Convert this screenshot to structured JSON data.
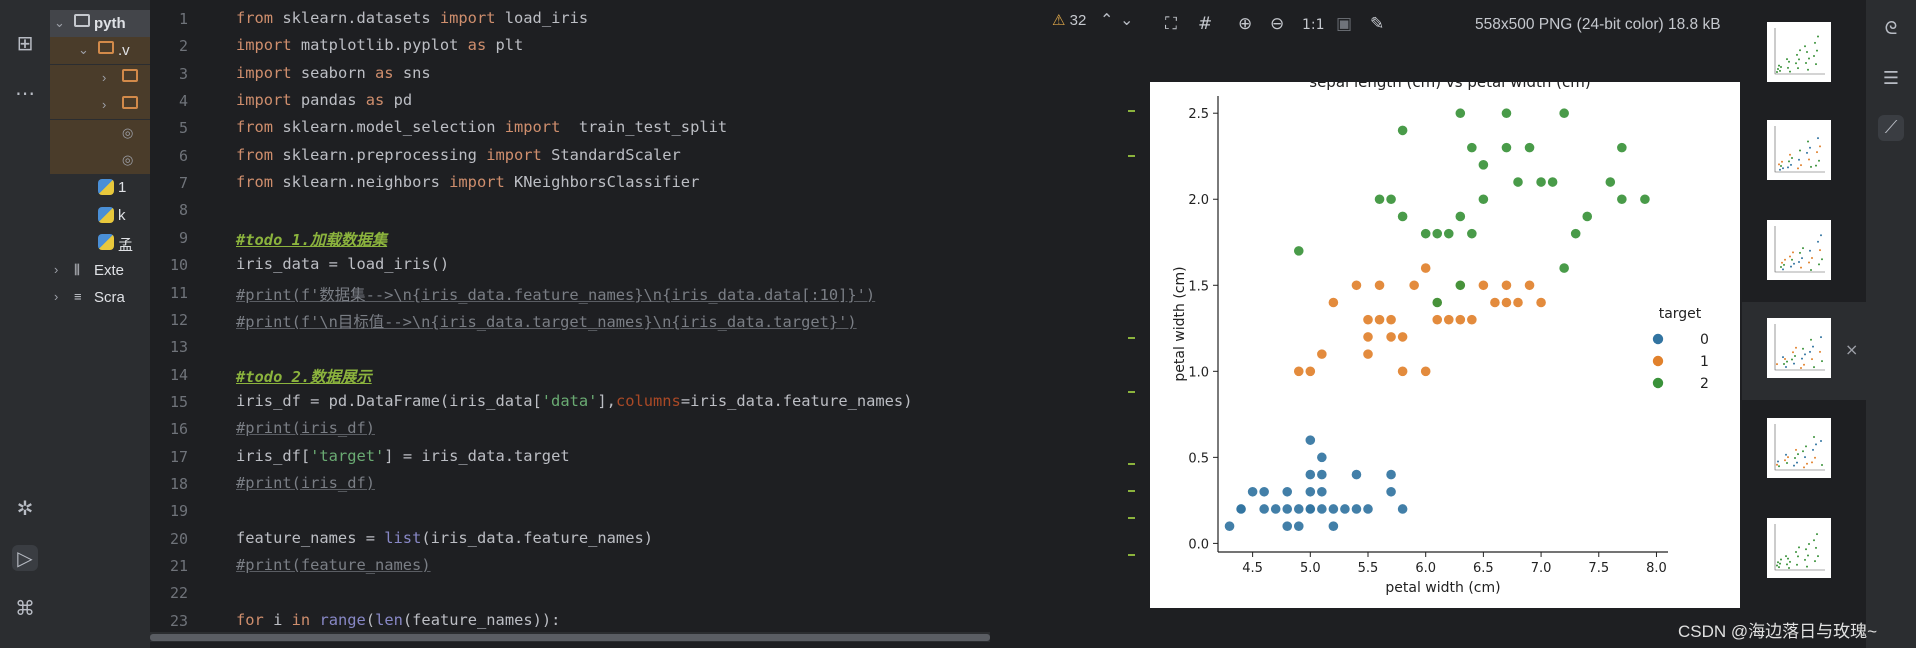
{
  "project_tree": [
    {
      "label": "pyth",
      "kind": "folder",
      "expanded": true,
      "depth": 0
    },
    {
      "label": ".v",
      "kind": "folder",
      "expanded": true,
      "depth": 1
    },
    {
      "label": "",
      "kind": "folder",
      "expanded": false,
      "depth": 2
    },
    {
      "label": "",
      "kind": "folder",
      "expanded": false,
      "depth": 2
    },
    {
      "label": "",
      "kind": "file",
      "depth": 2
    },
    {
      "label": "",
      "kind": "file",
      "depth": 2
    },
    {
      "label": "1",
      "kind": "python",
      "depth": 1
    },
    {
      "label": "k",
      "kind": "python",
      "depth": 1
    },
    {
      "label": "孟",
      "kind": "python",
      "depth": 1
    },
    {
      "label": "Exte",
      "kind": "library",
      "expanded": false,
      "depth": 0
    },
    {
      "label": "Scra",
      "kind": "scratch",
      "expanded": false,
      "depth": 0
    }
  ],
  "editor": {
    "warnings_count": "32",
    "lines": [
      {
        "n": "1",
        "tokens": [
          [
            "kw",
            "from"
          ],
          [
            "t",
            " sklearn.datasets "
          ],
          [
            "kw",
            "import"
          ],
          [
            "t",
            " load_iris"
          ]
        ]
      },
      {
        "n": "2",
        "tokens": [
          [
            "kw",
            "import"
          ],
          [
            "t",
            " matplotlib.pyplot "
          ],
          [
            "kw",
            "as"
          ],
          [
            "t",
            " plt"
          ]
        ]
      },
      {
        "n": "3",
        "tokens": [
          [
            "kw",
            "import"
          ],
          [
            "t",
            " seaborn "
          ],
          [
            "kw",
            "as"
          ],
          [
            "t",
            " sns"
          ]
        ]
      },
      {
        "n": "4",
        "tokens": [
          [
            "kw",
            "import"
          ],
          [
            "t",
            " pandas "
          ],
          [
            "kw",
            "as"
          ],
          [
            "t",
            " pd"
          ]
        ]
      },
      {
        "n": "5",
        "tokens": [
          [
            "kw",
            "from"
          ],
          [
            "t",
            " sklearn.model_selection "
          ],
          [
            "kw",
            "import"
          ],
          [
            "t",
            "  train_test_split"
          ]
        ]
      },
      {
        "n": "6",
        "tokens": [
          [
            "kw",
            "from"
          ],
          [
            "t",
            " sklearn.preprocessing "
          ],
          [
            "kw",
            "import"
          ],
          [
            "t",
            " StandardScaler"
          ]
        ]
      },
      {
        "n": "7",
        "tokens": [
          [
            "kw",
            "from"
          ],
          [
            "t",
            " sklearn.neighbors "
          ],
          [
            "kw",
            "import"
          ],
          [
            "t",
            " KNeighborsClassifier"
          ]
        ]
      },
      {
        "n": "8",
        "tokens": []
      },
      {
        "n": "9",
        "tokens": [
          [
            "todo",
            "#todo 1.加载数据集"
          ]
        ]
      },
      {
        "n": "10",
        "tokens": [
          [
            "t",
            "iris_data = load_iris()"
          ]
        ]
      },
      {
        "n": "11",
        "tokens": [
          [
            "cm",
            "#print(f'数据集-->\\n{iris_data.feature_names}\\n{iris_data.data[:10]}')"
          ]
        ]
      },
      {
        "n": "12",
        "tokens": [
          [
            "cm",
            "#print(f'\\n目标值-->\\n{iris_data.target_names}\\n{iris_data.target}')"
          ]
        ]
      },
      {
        "n": "13",
        "tokens": []
      },
      {
        "n": "14",
        "tokens": [
          [
            "todo",
            "#todo 2.数据展示"
          ]
        ]
      },
      {
        "n": "15",
        "tokens": [
          [
            "t",
            "iris_df = pd.DataFrame(iris_data["
          ],
          [
            "str",
            "'data'"
          ],
          [
            "t",
            "],"
          ],
          [
            "named",
            "columns"
          ],
          [
            "t",
            "=iris_data.feature_names)"
          ]
        ]
      },
      {
        "n": "16",
        "tokens": [
          [
            "cm",
            "#print(iris_df)"
          ]
        ]
      },
      {
        "n": "17",
        "tokens": [
          [
            "t",
            "iris_df["
          ],
          [
            "str",
            "'target'"
          ],
          [
            "t",
            "] = iris_data.target"
          ]
        ]
      },
      {
        "n": "18",
        "tokens": [
          [
            "cm",
            "#print(iris_df)"
          ]
        ]
      },
      {
        "n": "19",
        "tokens": []
      },
      {
        "n": "20",
        "tokens": [
          [
            "t",
            "feature_names = "
          ],
          [
            "bi",
            "list"
          ],
          [
            "t",
            "(iris_data.feature_names)"
          ]
        ]
      },
      {
        "n": "21",
        "tokens": [
          [
            "cm",
            "#print(feature_names)"
          ]
        ]
      },
      {
        "n": "22",
        "tokens": []
      },
      {
        "n": "23",
        "tokens": [
          [
            "kw",
            "for"
          ],
          [
            "t",
            " i "
          ],
          [
            "kw",
            "in"
          ],
          [
            "t",
            " "
          ],
          [
            "bi",
            "range"
          ],
          [
            "t",
            "("
          ],
          [
            "bi",
            "len"
          ],
          [
            "t",
            "(feature_names)):"
          ]
        ]
      }
    ]
  },
  "viewer": {
    "toolbar": {
      "fit_label": "1:1"
    },
    "image_info": "558x500 PNG (24-bit color) 18.8 kB"
  },
  "chart_data": {
    "type": "scatter",
    "title": "sepal length (cm) vs petal width (cm)",
    "xlabel": "petal width (cm)",
    "ylabel": "petal width (cm)",
    "xlim": [
      4.2,
      8.1
    ],
    "ylim": [
      -0.05,
      2.6
    ],
    "xticks": [
      "4.5",
      "5.0",
      "5.5",
      "6.0",
      "6.5",
      "7.0",
      "7.5",
      "8.0"
    ],
    "yticks": [
      "0.0",
      "0.5",
      "1.0",
      "1.5",
      "2.0",
      "2.5"
    ],
    "legend": {
      "title": "target",
      "position": "right",
      "labels": [
        "0",
        "1",
        "2"
      ]
    },
    "grid": false,
    "colors": [
      "#3274a1",
      "#e1812c",
      "#3a923a"
    ],
    "series": [
      {
        "name": "0",
        "points": [
          [
            4.3,
            0.1
          ],
          [
            4.4,
            0.2
          ],
          [
            4.4,
            0.2
          ],
          [
            4.5,
            0.3
          ],
          [
            4.6,
            0.2
          ],
          [
            4.6,
            0.3
          ],
          [
            4.7,
            0.2
          ],
          [
            4.8,
            0.2
          ],
          [
            4.8,
            0.1
          ],
          [
            4.8,
            0.3
          ],
          [
            4.9,
            0.1
          ],
          [
            4.9,
            0.2
          ],
          [
            5.0,
            0.2
          ],
          [
            5.0,
            0.3
          ],
          [
            5.0,
            0.4
          ],
          [
            5.0,
            0.6
          ],
          [
            5.0,
            0.2
          ],
          [
            5.1,
            0.2
          ],
          [
            5.1,
            0.3
          ],
          [
            5.1,
            0.4
          ],
          [
            5.1,
            0.5
          ],
          [
            5.2,
            0.1
          ],
          [
            5.2,
            0.2
          ],
          [
            5.3,
            0.2
          ],
          [
            5.4,
            0.2
          ],
          [
            5.4,
            0.4
          ],
          [
            5.5,
            0.2
          ],
          [
            5.7,
            0.3
          ],
          [
            5.7,
            0.4
          ],
          [
            5.8,
            0.2
          ]
        ]
      },
      {
        "name": "1",
        "points": [
          [
            4.9,
            1.0
          ],
          [
            5.0,
            1.0
          ],
          [
            5.1,
            1.1
          ],
          [
            5.2,
            1.4
          ],
          [
            5.5,
            1.3
          ],
          [
            5.5,
            1.2
          ],
          [
            5.5,
            1.1
          ],
          [
            5.6,
            1.3
          ],
          [
            5.6,
            1.5
          ],
          [
            5.7,
            1.3
          ],
          [
            5.8,
            1.0
          ],
          [
            5.8,
            1.2
          ],
          [
            5.9,
            1.5
          ],
          [
            6.0,
            1.0
          ],
          [
            6.0,
            1.6
          ],
          [
            6.1,
            1.3
          ],
          [
            6.1,
            1.4
          ],
          [
            6.2,
            1.3
          ],
          [
            6.3,
            1.5
          ],
          [
            6.4,
            1.3
          ],
          [
            6.5,
            1.5
          ],
          [
            6.6,
            1.4
          ],
          [
            6.7,
            1.4
          ],
          [
            6.7,
            1.5
          ],
          [
            6.8,
            1.4
          ],
          [
            6.9,
            1.5
          ],
          [
            7.0,
            1.4
          ],
          [
            5.4,
            1.5
          ],
          [
            6.3,
            1.3
          ],
          [
            5.7,
            1.2
          ]
        ]
      },
      {
        "name": "2",
        "points": [
          [
            4.9,
            1.7
          ],
          [
            5.6,
            2.0
          ],
          [
            5.7,
            2.0
          ],
          [
            5.8,
            2.4
          ],
          [
            5.8,
            1.9
          ],
          [
            6.0,
            1.8
          ],
          [
            6.1,
            1.8
          ],
          [
            6.2,
            1.8
          ],
          [
            6.3,
            2.5
          ],
          [
            6.3,
            1.9
          ],
          [
            6.4,
            2.3
          ],
          [
            6.4,
            1.8
          ],
          [
            6.5,
            2.2
          ],
          [
            6.5,
            2.0
          ],
          [
            6.7,
            2.5
          ],
          [
            6.7,
            2.3
          ],
          [
            6.8,
            2.1
          ],
          [
            6.9,
            2.3
          ],
          [
            7.0,
            2.1
          ],
          [
            7.1,
            2.1
          ],
          [
            7.2,
            2.5
          ],
          [
            7.2,
            1.6
          ],
          [
            7.3,
            1.8
          ],
          [
            7.4,
            1.9
          ],
          [
            7.6,
            2.1
          ],
          [
            7.7,
            2.3
          ],
          [
            7.7,
            2.0
          ],
          [
            7.9,
            2.0
          ],
          [
            6.1,
            1.4
          ],
          [
            6.3,
            1.5
          ]
        ]
      }
    ]
  },
  "thumbnails": [
    "thumb-1",
    "thumb-2",
    "thumb-3",
    "thumb-4",
    "thumb-5",
    "thumb-6"
  ],
  "watermark": "CSDN @海边落日与玫瑰~"
}
